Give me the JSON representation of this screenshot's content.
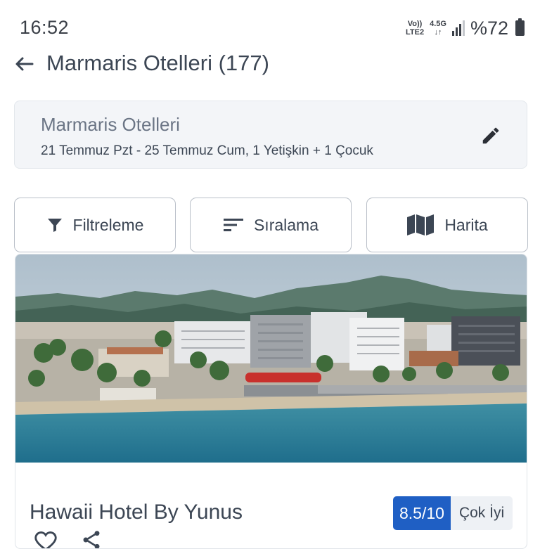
{
  "status": {
    "time": "16:52",
    "volte_top": "Vo))",
    "volte_bottom": "LTE2",
    "net_top": "4.5G",
    "net_bottom": "↓↑",
    "battery": "%72"
  },
  "header": {
    "title": "Marmaris Otelleri (177)",
    "back_icon": "arrow-left-icon"
  },
  "search": {
    "destination": "Marmaris Otelleri",
    "details": "21 Temmuz Pzt - 25 Temmuz Cum, 1 Yetişkin + 1 Çocuk",
    "edit_icon": "pencil-icon"
  },
  "actions": [
    {
      "label": "Filtreleme",
      "icon": "filter-icon"
    },
    {
      "label": "Sıralama",
      "icon": "sort-icon"
    },
    {
      "label": "Harita",
      "icon": "map-icon"
    }
  ],
  "hotel": {
    "name": "Hawaii Hotel By Yunus",
    "score": "8.5/10",
    "score_label": "Çok İyi",
    "image": "hotel-beachfront-photo"
  },
  "colors": {
    "accent": "#1f5fc4",
    "text": "#3c4654",
    "border": "#b9bfc8"
  }
}
